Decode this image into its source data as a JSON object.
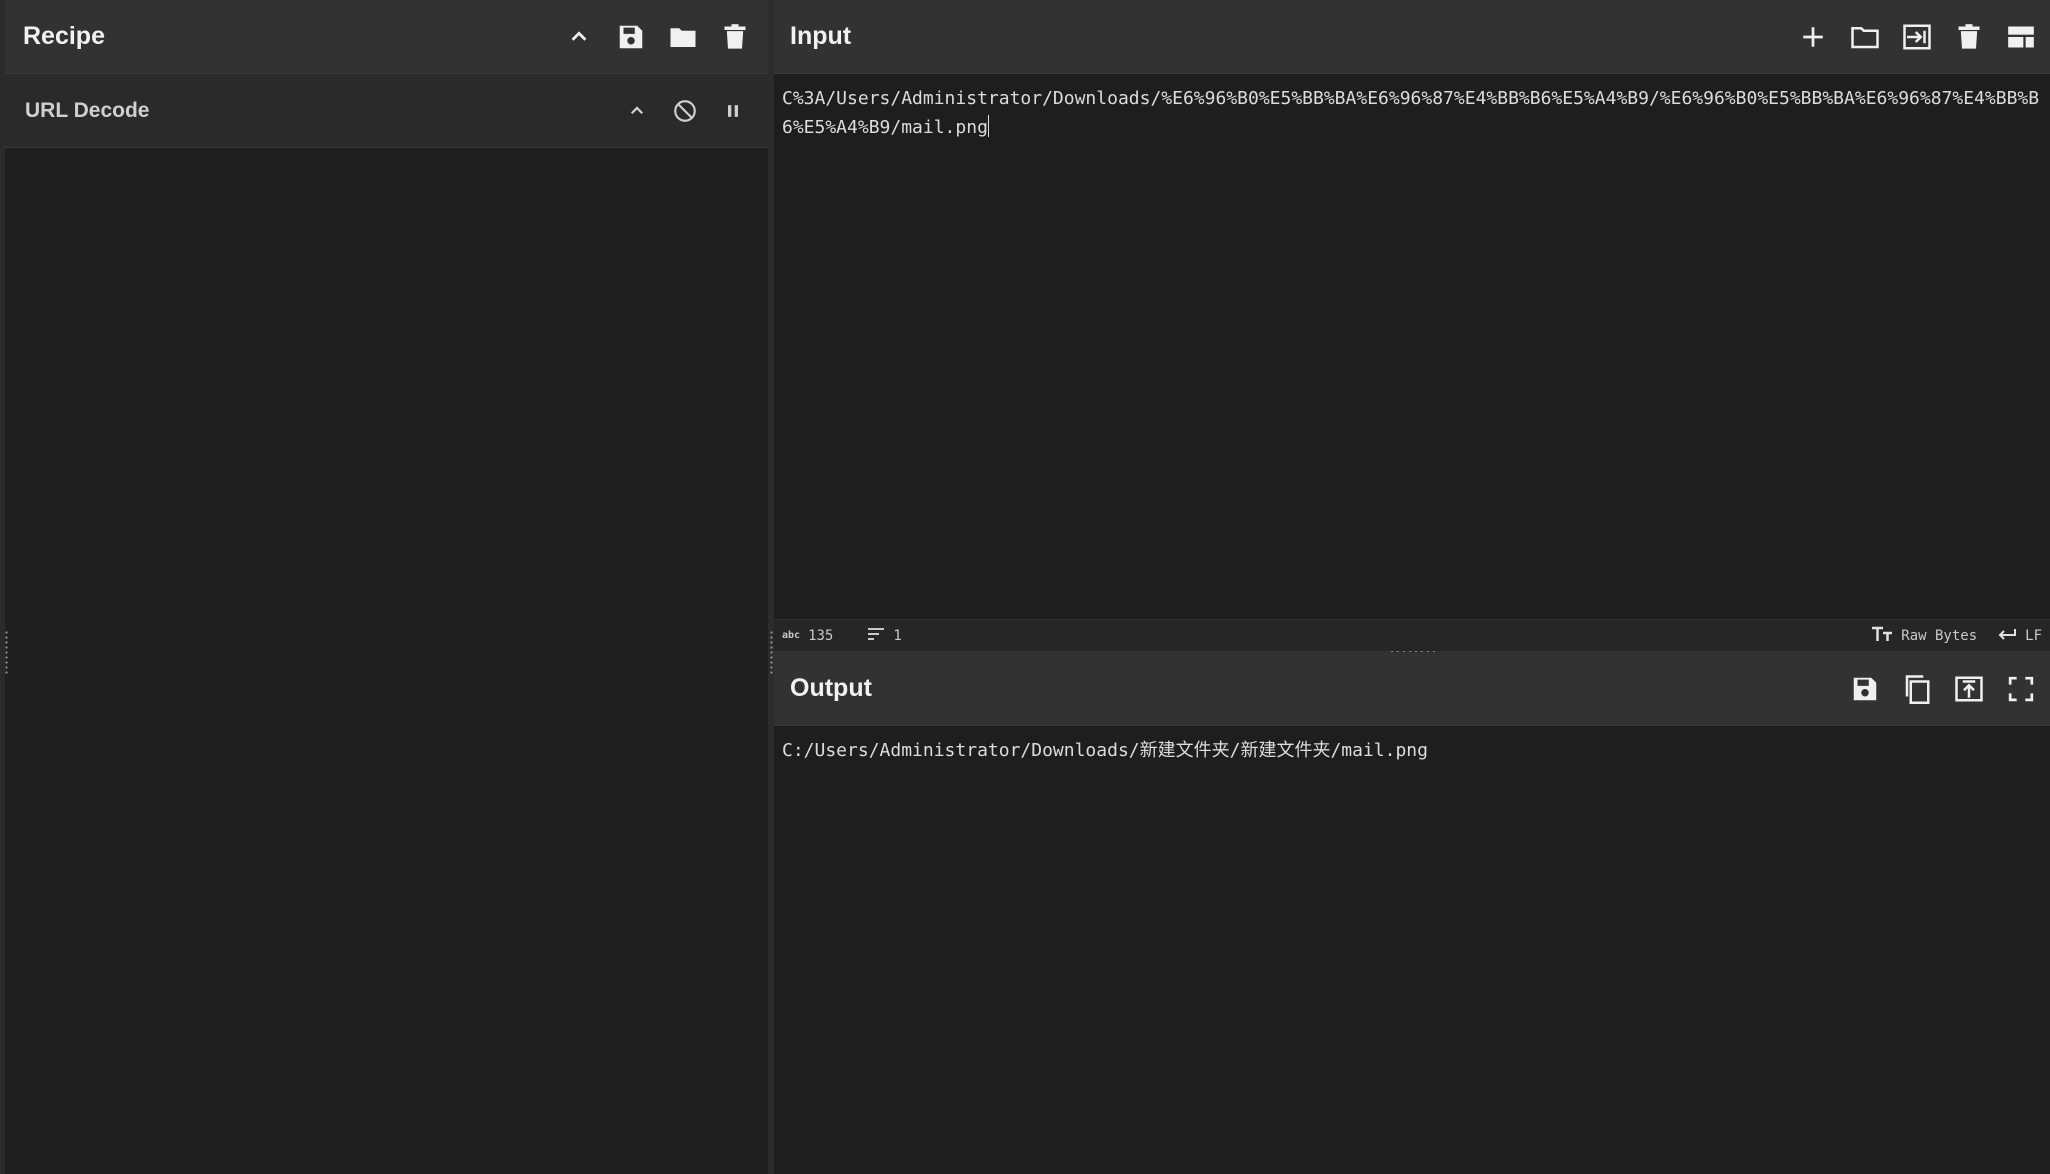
{
  "recipe": {
    "title": "Recipe",
    "operation": {
      "name": "URL Decode"
    }
  },
  "input": {
    "title": "Input",
    "text": "C%3A/Users/Administrator/Downloads/%E6%96%B0%E5%BB%BA%E6%96%87%E4%BB%B6%E5%A4%B9/%E6%96%B0%E5%BB%BA%E6%96%87%E4%BB%B6%E5%A4%B9/mail.png",
    "status": {
      "length_icon_label": "abc",
      "length": "135",
      "lines": "1",
      "encoding": "Raw Bytes",
      "eol": "LF"
    }
  },
  "output": {
    "title": "Output",
    "text": "C:/Users/Administrator/Downloads/新建文件夹/新建文件夹/mail.png"
  },
  "colors": {
    "background": "#1e1e1e",
    "header": "#323232",
    "operation_row": "#2a2a2a",
    "text": "#e8e8e8"
  }
}
